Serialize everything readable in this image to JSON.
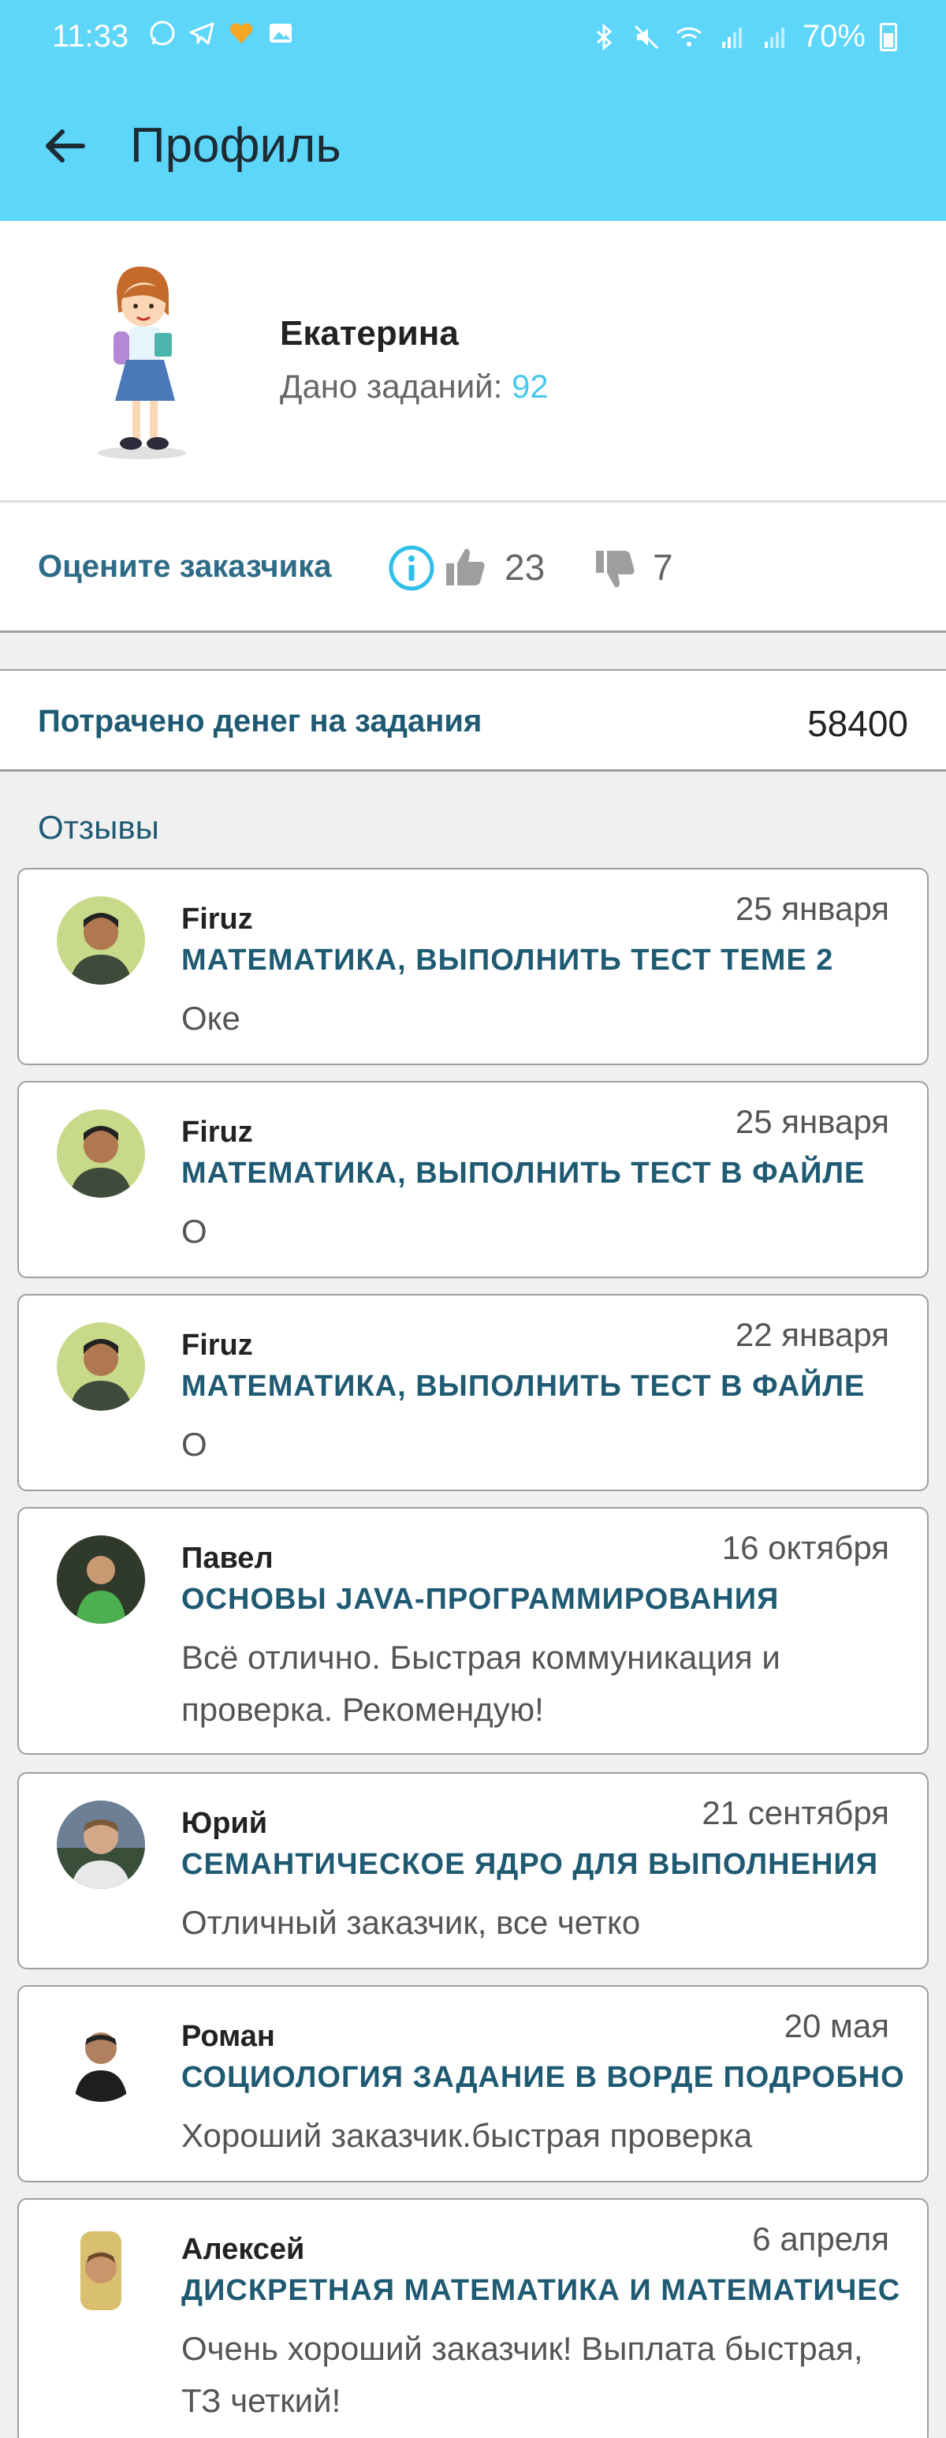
{
  "status_bar": {
    "time": "11:33",
    "battery": "70%",
    "left_icons": [
      "whatsapp-icon",
      "telegram-icon",
      "heart-badge-icon",
      "gallery-icon"
    ],
    "right_icons": [
      "bluetooth-icon",
      "mute-icon",
      "wifi-icon",
      "signal-icon",
      "signal-icon"
    ]
  },
  "header": {
    "title": "Профиль",
    "back_icon": "arrow-back-icon"
  },
  "profile": {
    "name": "Екатерина",
    "tasks_label": "Дано заданий: ",
    "tasks_count": "92"
  },
  "rating": {
    "label": "Оцените заказчика",
    "likes": "23",
    "dislikes": "7"
  },
  "money": {
    "label": "Потрачено денег на задания",
    "value": "58400"
  },
  "reviews": {
    "title": "Отзывы",
    "items": [
      {
        "name": "Firuz",
        "date": "25 января",
        "task": "МАТЕМАТИКА, ВЫПОЛНИТЬ ТЕСТ ТЕМЕ 2",
        "text": "Оке"
      },
      {
        "name": "Firuz",
        "date": "25 января",
        "task": "МАТЕМАТИКА, ВЫПОЛНИТЬ ТЕСТ В ФАЙЛЕ",
        "text": "О"
      },
      {
        "name": "Firuz",
        "date": "22 января",
        "task": "МАТЕМАТИКА, ВЫПОЛНИТЬ ТЕСТ В ФАЙЛЕ",
        "text": "О"
      },
      {
        "name": "Павел",
        "date": "16 октября",
        "task": "ОСНОВЫ JAVA-ПРОГРАММИРОВАНИЯ",
        "text": "Всё отлично. Быстрая коммуникация и проверка. Рекомендую!"
      },
      {
        "name": "Юрий",
        "date": "21 сентября",
        "task": "СЕМАНТИЧЕСКОЕ ЯДРО ДЛЯ ВЫПОЛНЕНИЯ",
        "text": "Отличный заказчик, все четко"
      },
      {
        "name": "Роман",
        "date": "20 мая",
        "task": "СОЦИОЛОГИЯ ЗАДАНИЕ В ВОРДЕ ПОДРОБНО",
        "text": "Хороший заказчик.быстрая проверка"
      },
      {
        "name": "Алексей",
        "date": "6 апреля",
        "task": "ДИСКРЕТНАЯ МАТЕМАТИКА И МАТЕМАТИЧЕС",
        "text": "Очень хороший заказчик! Выплата быстрая, ТЗ четкий!"
      }
    ]
  },
  "colors": {
    "app_bar": "#5dd6fa",
    "accent_text": "#1f5a73",
    "count_highlight": "#48c8ee"
  }
}
